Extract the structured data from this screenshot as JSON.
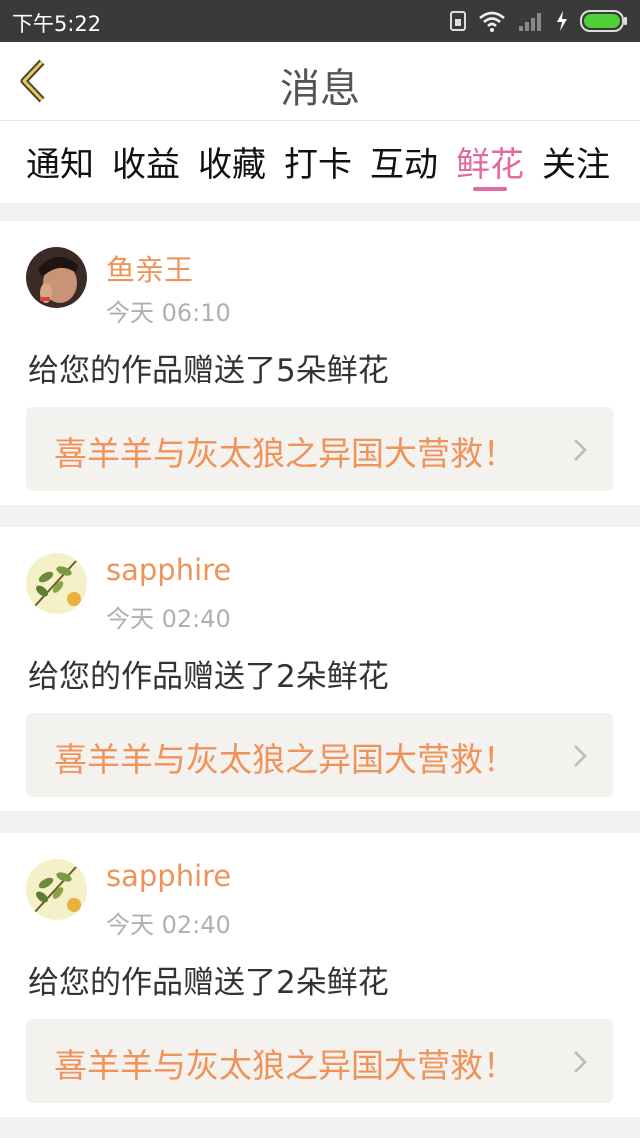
{
  "status_bar": {
    "time": "下午5:22"
  },
  "header": {
    "title": "消息"
  },
  "tabs": [
    {
      "label": "通知"
    },
    {
      "label": "收益"
    },
    {
      "label": "收藏"
    },
    {
      "label": "打卡"
    },
    {
      "label": "互动"
    },
    {
      "label": "鲜花",
      "active": true
    },
    {
      "label": "关注"
    }
  ],
  "messages": [
    {
      "user": "鱼亲王",
      "time": "今天 06:10",
      "text": "给您的作品赠送了5朵鲜花",
      "work_title": "喜羊羊与灰太狼之异国大营救！"
    },
    {
      "user": "sapphire",
      "time": "今天 02:40",
      "text": "给您的作品赠送了2朵鲜花",
      "work_title": "喜羊羊与灰太狼之异国大营救！"
    },
    {
      "user": "sapphire",
      "time": "今天 02:40",
      "text": "给您的作品赠送了2朵鲜花",
      "work_title": "喜羊羊与灰太狼之异国大营救！"
    }
  ],
  "colors": {
    "accent_pink": "#e26aa0",
    "accent_orange": "#f0935a",
    "status_bar": "#3a3a3a",
    "battery": "#4cd137"
  },
  "icons": [
    "back-chevron-icon",
    "sim-icon",
    "wifi-icon",
    "signal-icon",
    "charging-icon",
    "battery-icon",
    "chevron-right-icon"
  ]
}
